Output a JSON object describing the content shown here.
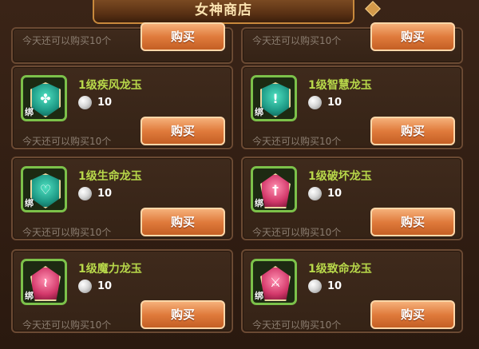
{
  "window": {
    "title": "女神商店"
  },
  "partial_cards": [
    {
      "limit_text": "今天还可以购买10个",
      "buy_label": "购买"
    },
    {
      "limit_text": "今天还可以购买10个",
      "buy_label": "购买"
    }
  ],
  "items": [
    {
      "name": "1级疾风龙玉",
      "price": "10",
      "bind_label": "绑",
      "limit_text": "今天还可以购买10个",
      "buy_label": "购买",
      "icon": "wind-jade-icon",
      "gem_color": "green",
      "symbol": "✤"
    },
    {
      "name": "1级智慧龙玉",
      "price": "10",
      "bind_label": "绑",
      "limit_text": "今天还可以购买10个",
      "buy_label": "购买",
      "icon": "wisdom-jade-icon",
      "gem_color": "green",
      "symbol": "!"
    },
    {
      "name": "1级生命龙玉",
      "price": "10",
      "bind_label": "绑",
      "limit_text": "今天还可以购买10个",
      "buy_label": "购买",
      "icon": "life-jade-icon",
      "gem_color": "green",
      "symbol": "♡"
    },
    {
      "name": "1级破坏龙玉",
      "price": "10",
      "bind_label": "绑",
      "limit_text": "今天还可以购买10个",
      "buy_label": "购买",
      "icon": "destruction-jade-icon",
      "gem_color": "pink",
      "symbol": "†"
    },
    {
      "name": "1级魔力龙玉",
      "price": "10",
      "bind_label": "绑",
      "limit_text": "今天还可以购买10个",
      "buy_label": "购买",
      "icon": "magic-jade-icon",
      "gem_color": "pink",
      "symbol": "≀"
    },
    {
      "name": "1级致命龙玉",
      "price": "10",
      "bind_label": "绑",
      "limit_text": "今天还可以购买10个",
      "buy_label": "购买",
      "icon": "lethal-jade-icon",
      "gem_color": "pink",
      "symbol": "⚔"
    }
  ],
  "colors": {
    "item_name": "#b8d84a",
    "button": "#e07b3c",
    "frame": "#6b4a33"
  }
}
